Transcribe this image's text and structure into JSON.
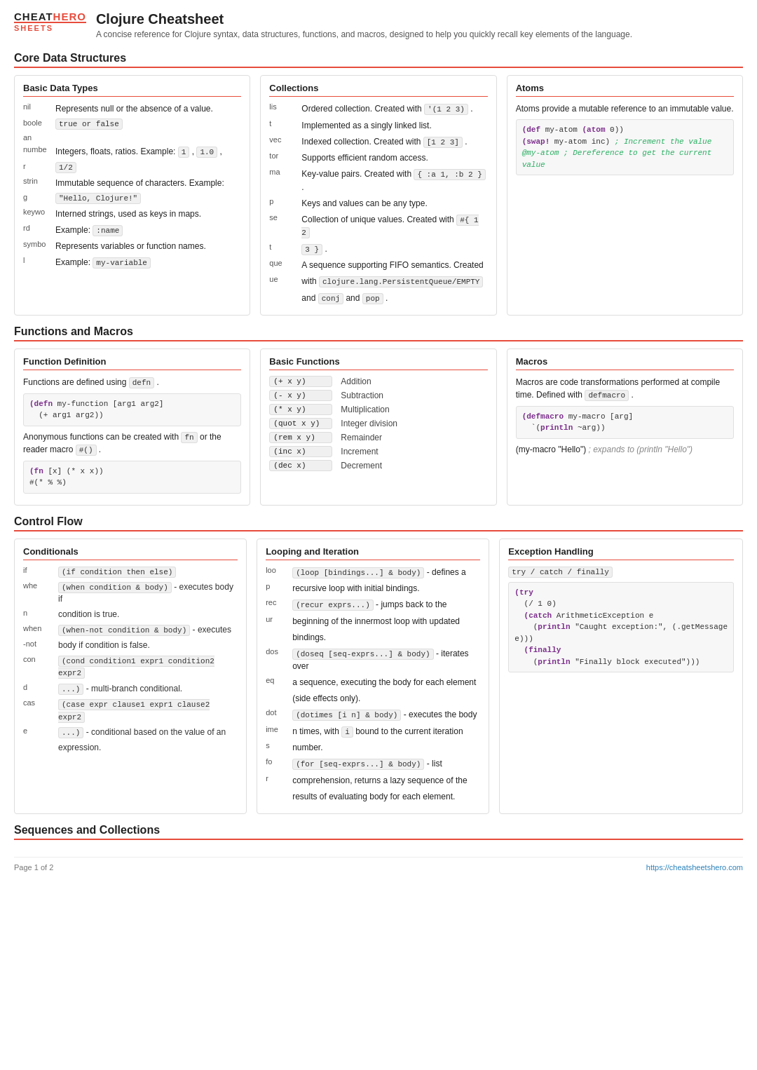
{
  "header": {
    "logo_top": [
      "CHEAT",
      "HERO"
    ],
    "logo_bottom": [
      "SHEETS"
    ],
    "title": "Clojure Cheatsheet",
    "subtitle": "A concise reference for Clojure syntax, data structures, functions, and macros, designed to help you quickly recall key elements of the language."
  },
  "sections": {
    "core_data": "Core Data Structures",
    "functions_macros": "Functions and Macros",
    "control_flow": "Control Flow",
    "sequences": "Sequences and Collections"
  },
  "basic_data_types": {
    "title": "Basic Data Types",
    "rows": [
      {
        "key": "nil",
        "desc": "Represents null or the absence of a value."
      },
      {
        "key": "boole",
        "code": "true or false"
      },
      {
        "key": "an",
        "desc": ""
      },
      {
        "key": "numbe",
        "desc": "Integers, floats, ratios. Example:",
        "codes": [
          "1",
          "1.0",
          "1/2"
        ]
      },
      {
        "key": "r",
        "code": "1/2"
      },
      {
        "key": "strin",
        "desc": "Immutable sequence of characters. Example:"
      },
      {
        "key": "g",
        "code": "\"Hello, Clojure!\""
      },
      {
        "key": "keywo",
        "desc": "Interned strings, used as keys in maps."
      },
      {
        "key": "rd",
        "desc": "Example:",
        "code": ":name"
      },
      {
        "key": "symbo",
        "desc": "Represents variables or function names."
      },
      {
        "key": "l",
        "desc": "Example:",
        "code": "my-variable"
      }
    ]
  },
  "collections": {
    "title": "Collections",
    "rows": [
      {
        "key": "lis",
        "desc": "Ordered collection. Created with",
        "code": "'(1 2 3)",
        "desc2": "."
      },
      {
        "key": "t",
        "desc": "Implemented as a singly linked list."
      },
      {
        "key": "vec",
        "desc": "Indexed collection. Created with",
        "code": "[1 2 3]",
        "desc2": "."
      },
      {
        "key": "tor",
        "desc": "Supports efficient random access."
      },
      {
        "key": "ma",
        "desc": "Key-value pairs. Created with",
        "code": "{ :a 1, :b 2 }",
        "desc2": "."
      },
      {
        "key": "p",
        "desc": "Keys and values can be any type."
      },
      {
        "key": "se",
        "desc": "Collection of unique values. Created with",
        "code": "#{ 1 2 3 }",
        "desc2": "."
      },
      {
        "key": "t",
        "desc": ""
      },
      {
        "key": "que",
        "desc": "A sequence supporting FIFO semantics. Created"
      },
      {
        "key": "ue",
        "desc": "with",
        "code": "clojure.lang.PersistentQueue/EMPTY",
        "desc2": ""
      },
      {
        "key": "",
        "desc": "and",
        "code2": "conj",
        "desc3": "and",
        "code3": "pop",
        "desc4": "."
      }
    ]
  },
  "atoms": {
    "title": "Atoms",
    "desc": "Atoms provide a mutable reference to an immutable value.",
    "code1": "(def my-atom (atom 0))",
    "code2": "(swap! my-atom inc) ; Increment the value",
    "code3": "@my-atom ; Dereference to get the current value"
  },
  "function_def": {
    "title": "Function Definition",
    "desc1": "Functions are defined using",
    "code_defn": "defn",
    "desc2": ".",
    "code_block": "(defn my-function [arg1 arg2]\n  (+ arg1 arg2))",
    "desc3": "Anonymous functions can be created with",
    "code_fn": "fn",
    "desc4": "or the reader macro",
    "code_hash": "#()",
    "desc5": ".",
    "code_block2": "(fn [x] (* x x))\n#(* % %)"
  },
  "basic_functions": {
    "title": "Basic Functions",
    "rows": [
      {
        "func": "(+ x y)",
        "desc": "Addition"
      },
      {
        "func": "(- x y)",
        "desc": "Subtraction"
      },
      {
        "func": "(* x y)",
        "desc": "Multiplication"
      },
      {
        "func": "(quot x y)",
        "desc": "Integer division"
      },
      {
        "func": "(rem x y)",
        "desc": "Remainder"
      },
      {
        "func": "(inc x)",
        "desc": "Increment"
      },
      {
        "func": "(dec x)",
        "desc": "Decrement"
      }
    ]
  },
  "macros": {
    "title": "Macros",
    "desc1": "Macros are code transformations performed at compile time. Defined with",
    "code_defmacro": "defmacro",
    "desc2": ".",
    "code_block": "(defmacro my-macro [arg]\n  `(println ~arg))",
    "desc3": "(my-macro \"Hello\") ; expands to (println \"Hello\")"
  },
  "conditionals": {
    "title": "Conditionals",
    "rows": [
      {
        "key": "if",
        "code": "(if condition then else)",
        "desc": ""
      },
      {
        "key": "whe",
        "code": "(when condition & body)",
        "desc": "- executes body if"
      },
      {
        "key": "n",
        "desc": "condition is true."
      },
      {
        "key": "when",
        "code": "(when-not condition & body)",
        "desc": "- executes"
      },
      {
        "key": "-not",
        "desc": "body if condition is false."
      },
      {
        "key": "con",
        "code": "(cond condition1 expr1 condition2 expr2",
        "desc": ""
      },
      {
        "key": "d",
        "code": "...)",
        "desc": "- multi-branch conditional."
      },
      {
        "key": "cas",
        "code": "(case expr clause1 expr1 clause2 expr2",
        "desc": ""
      },
      {
        "key": "e",
        "code": "...)",
        "desc": "- conditional based on the value of an"
      },
      {
        "key": "",
        "desc": "expression."
      }
    ]
  },
  "looping": {
    "title": "Looping and Iteration",
    "rows": [
      {
        "key": "loo",
        "code": "(loop [bindings...] & body)",
        "desc": "- defines a"
      },
      {
        "key": "p",
        "desc": "recursive loop with initial bindings."
      },
      {
        "key": "rec",
        "code": "(recur exprs...)",
        "desc": "- jumps back to the"
      },
      {
        "key": "ur",
        "desc": "beginning of the innermost loop with updated"
      },
      {
        "key": "",
        "desc": "bindings."
      },
      {
        "key": "dos",
        "code": "(doseq [seq-exprs...] & body)",
        "desc": "- iterates over"
      },
      {
        "key": "eq",
        "desc": "a sequence, executing the body for each element"
      },
      {
        "key": "",
        "desc": "(side effects only)."
      },
      {
        "key": "dot",
        "code": "(dotimes [i n] & body)",
        "desc": "- executes the body"
      },
      {
        "key": "ime",
        "desc": "n times, with",
        "code_inline": "i",
        "desc2": "bound to the current iteration"
      },
      {
        "key": "s",
        "desc": "number."
      },
      {
        "key": "fo",
        "code": "(for [seq-exprs...] & body)",
        "desc": "- list"
      },
      {
        "key": "r",
        "desc": "comprehension, returns a lazy sequence of the"
      },
      {
        "key": "",
        "desc": "results of evaluating body for each element."
      }
    ]
  },
  "exception_handling": {
    "title": "Exception Handling",
    "code_try": "try / catch / finally",
    "code_block": "(try\n  (/ 1 0)\n  (catch ArithmeticException e\n    (println \"Caught exception:\", (.getMessage\ne)))\n  (finally\n    (println \"Finally block executed\")))"
  },
  "footer": {
    "page": "Page 1 of 2",
    "url": "https://cheatsheetshero.com"
  }
}
